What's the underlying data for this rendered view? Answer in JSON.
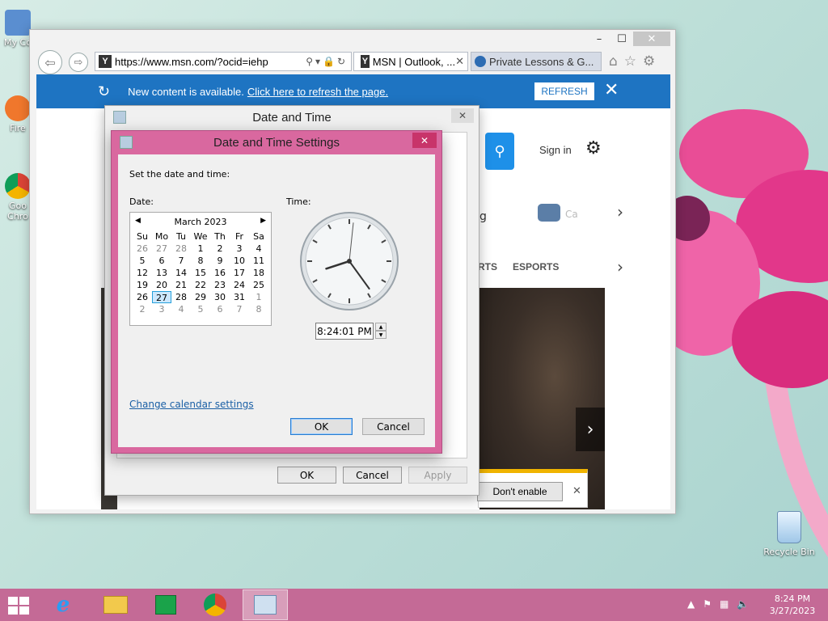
{
  "desktop": {
    "icons": [
      {
        "label": "My Co"
      },
      {
        "label": "Fire"
      },
      {
        "label": "Goo Chro"
      }
    ],
    "recycle_bin": "Recycle Bin"
  },
  "browser": {
    "address_url": "https://www.msn.com/?ocid=iehp",
    "tabs": [
      {
        "label": "MSN | Outlook, ..."
      },
      {
        "label": "Private Lessons & G..."
      }
    ],
    "notification": {
      "text": "New content is available.",
      "link": "Click here to refresh the page.",
      "button": "REFRESH"
    },
    "page": {
      "sign_in": "Sign in",
      "partial_g": "g",
      "car_text": "Ca",
      "rts": "RTS",
      "esports": "ESPORTS",
      "dont_enable": "Don't enable"
    }
  },
  "date_time_dialog": {
    "title": "Date and Time",
    "buttons": {
      "ok": "OK",
      "cancel": "Cancel",
      "apply": "Apply"
    }
  },
  "settings_dialog": {
    "title": "Date and Time Settings",
    "instruction": "Set the date and time:",
    "date_label": "Date:",
    "time_label": "Time:",
    "calendar": {
      "month_year": "March 2023",
      "weekdays": [
        "Su",
        "Mo",
        "Tu",
        "We",
        "Th",
        "Fr",
        "Sa"
      ],
      "weeks": [
        [
          "26",
          "27",
          "28",
          "1",
          "2",
          "3",
          "4"
        ],
        [
          "5",
          "6",
          "7",
          "8",
          "9",
          "10",
          "11"
        ],
        [
          "12",
          "13",
          "14",
          "15",
          "16",
          "17",
          "18"
        ],
        [
          "19",
          "20",
          "21",
          "22",
          "23",
          "24",
          "25"
        ],
        [
          "26",
          "27",
          "28",
          "29",
          "30",
          "31",
          "1"
        ],
        [
          "2",
          "3",
          "4",
          "5",
          "6",
          "7",
          "8"
        ]
      ],
      "selected_day": "27"
    },
    "time_value": "8:24:01 PM",
    "clock": {
      "hour": 8,
      "minute": 24,
      "second": 1
    },
    "change_calendar_link": "Change calendar settings",
    "buttons": {
      "ok": "OK",
      "cancel": "Cancel"
    }
  },
  "taskbar": {
    "time": "8:24 PM",
    "date": "3/27/2023"
  }
}
